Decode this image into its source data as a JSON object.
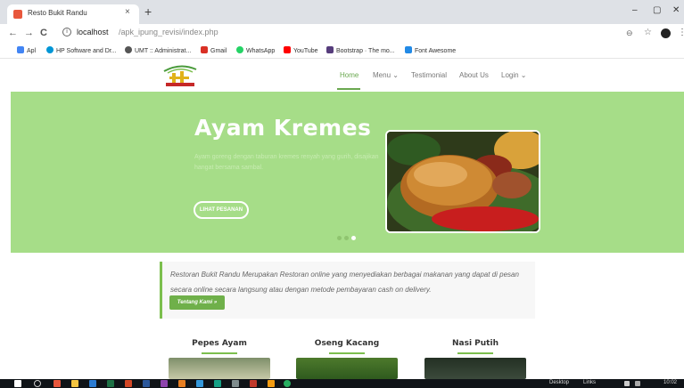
{
  "browser": {
    "tab_title": "Resto Bukit Randu",
    "tab_close": "×",
    "new_tab": "+",
    "url_host": "localhost",
    "url_path": "/apk_ipung_revisi/index.php",
    "window_controls": {
      "minimize": "–",
      "maximize": "▢",
      "close": "✕"
    },
    "nav": {
      "back": "←",
      "forward": "→",
      "reload": "C"
    },
    "bookmarks": [
      {
        "label": "Apl",
        "icon": "apps-grid-icon",
        "color": "#4285f4"
      },
      {
        "label": "HP Software and Dr...",
        "icon": "hp-icon",
        "color": "#0096d6"
      },
      {
        "label": "UMT :: Administrat...",
        "icon": "globe-icon",
        "color": "#555555"
      },
      {
        "label": "Gmail",
        "icon": "gmail-icon",
        "color": "#d93025"
      },
      {
        "label": "WhatsApp",
        "icon": "whatsapp-icon",
        "color": "#25d366"
      },
      {
        "label": "YouTube",
        "icon": "youtube-icon",
        "color": "#ff0000"
      },
      {
        "label": "Bootstrap · The mo...",
        "icon": "bootstrap-icon",
        "color": "#563d7c"
      },
      {
        "label": "Font Awesome",
        "icon": "fontawesome-icon",
        "color": "#228ae6"
      }
    ]
  },
  "site": {
    "nav": {
      "home": "Home",
      "menu": "Menu ⌄",
      "testimonial": "Testimonial",
      "about": "About Us",
      "login": "Login ⌄"
    },
    "hero": {
      "title": "Ayam Kremes",
      "text": "Ayam goreng dengan taburan kremes renyah yang gurih, disajikan hangat bersama sambal.",
      "button": "LIHAT PESANAN"
    },
    "about": {
      "text": "Restoran Bukit Randu Merupakan Restoran online yang menyediakan berbagai makanan yang dapat di pesan secara online secara langsung atau dengan metode pembayaran cash on delivery.",
      "button": "Tentang Kami »"
    },
    "menu_cards": [
      {
        "title": "Pepes Ayam"
      },
      {
        "title": "Oseng Kacang"
      },
      {
        "title": "Nasi Putih"
      }
    ]
  },
  "taskbar": {
    "desktop_label": "Desktop",
    "links_label": "Links",
    "time": "10:02"
  },
  "colors": {
    "accent_green": "#6aa84f",
    "hero_bg": "#a6dd88"
  }
}
